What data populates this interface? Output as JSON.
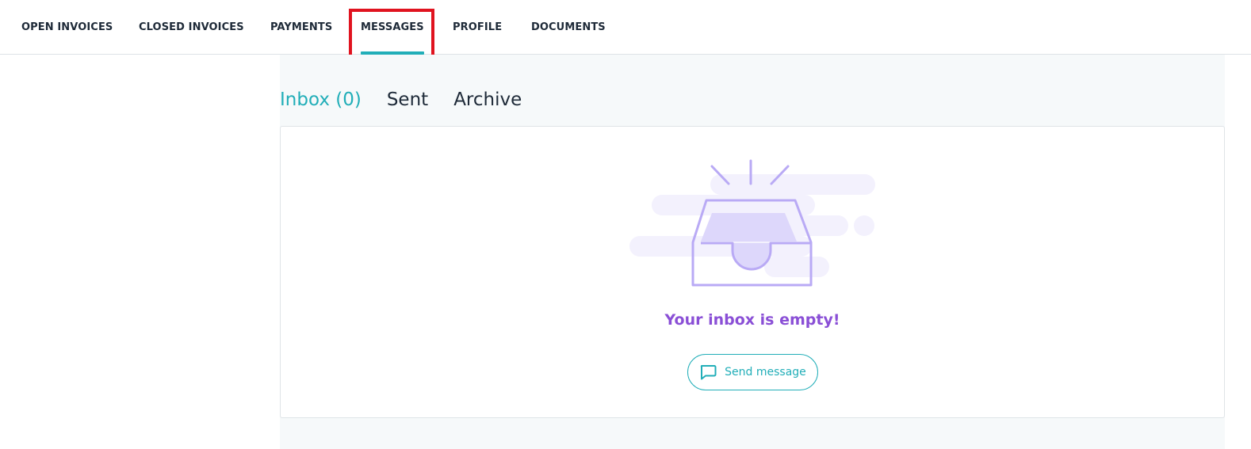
{
  "nav": {
    "items": [
      {
        "label": "OPEN INVOICES",
        "active": false
      },
      {
        "label": "CLOSED INVOICES",
        "active": false
      },
      {
        "label": "PAYMENTS",
        "active": false
      },
      {
        "label": "MESSAGES",
        "active": true
      },
      {
        "label": "PROFILE",
        "active": false
      },
      {
        "label": "DOCUMENTS",
        "active": false
      }
    ]
  },
  "messages": {
    "tabs": [
      {
        "label": "Inbox (0)",
        "active": true
      },
      {
        "label": "Sent",
        "active": false
      },
      {
        "label": "Archive",
        "active": false
      }
    ],
    "empty_state": {
      "icon": "inbox-tray-icon",
      "text": "Your inbox is empty!",
      "button_label": "Send message",
      "button_icon": "chat-bubble-icon"
    }
  },
  "colors": {
    "accent": "#21aeb8",
    "empty_text": "#8a4fd6",
    "illustration": "#b9aaf5",
    "illustration_fill": "#ddd7fb",
    "illustration_bg": "#f3f1fd",
    "highlight": "#e0131f"
  }
}
